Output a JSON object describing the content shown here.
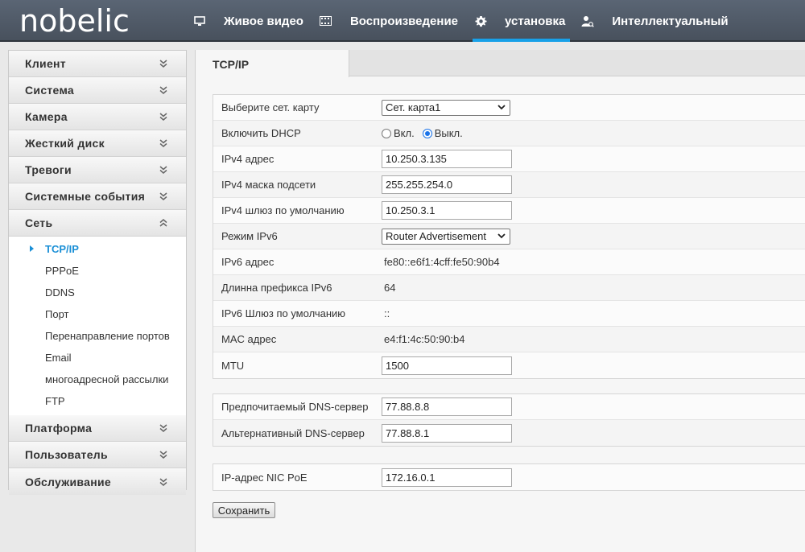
{
  "brand": {
    "logo": "nobelic"
  },
  "nav": [
    {
      "icon": "monitor-icon",
      "label": "Живое видео",
      "active": false
    },
    {
      "icon": "film-icon",
      "label": "Воспроизведение",
      "active": false
    },
    {
      "icon": "gear-icon",
      "label": "установка",
      "active": true
    },
    {
      "icon": "person-search-icon",
      "label": "Интеллектуальный",
      "active": false
    }
  ],
  "sidebar": {
    "groups_top": [
      "Клиент",
      "Система",
      "Камера",
      "Жесткий диск",
      "Тревоги",
      "Системные события"
    ],
    "open_group": "Сеть",
    "sub_items": [
      "TCP/IP",
      "PPPoE",
      "DDNS",
      "Порт",
      "Перенаправление портов",
      "Email",
      "многоадресной рассылки",
      "FTP"
    ],
    "active_sub": "TCP/IP",
    "groups_bottom": [
      "Платформа",
      "Пользователь",
      "Обслуживание"
    ]
  },
  "content": {
    "tab": "TCP/IP",
    "nic": {
      "label": "Выберите сет. карту",
      "value": "Сет. карта1"
    },
    "dhcp": {
      "label": "Включить DHCP",
      "on_label": "Вкл.",
      "off_label": "Выкл.",
      "selected": "off"
    },
    "ipv4_addr": {
      "label": "IPv4 адрес",
      "value": "10.250.3.135"
    },
    "ipv4_mask": {
      "label": "IPv4 маска подсети",
      "value": "255.255.254.0"
    },
    "ipv4_gw": {
      "label": "IPv4 шлюз по умолчанию",
      "value": "10.250.3.1"
    },
    "ipv6_mode": {
      "label": "Режим IPv6",
      "value": "Router Advertisement"
    },
    "ipv6_addr": {
      "label": "IPv6 адрес",
      "value": "fe80::e6f1:4cff:fe50:90b4"
    },
    "ipv6_prefix": {
      "label": "Длинна префикса IPv6",
      "value": "64"
    },
    "ipv6_gw": {
      "label": "IPv6 Шлюз по умолчанию",
      "value": "::"
    },
    "mac": {
      "label": "MAC адрес",
      "value": "e4:f1:4c:50:90:b4"
    },
    "mtu": {
      "label": "MTU",
      "value": "1500"
    },
    "dns_pref": {
      "label": "Предпочитаемый DNS-сервер",
      "value": "77.88.8.8"
    },
    "dns_alt": {
      "label": "Альтернативный DNS-сервер",
      "value": "77.88.8.1"
    },
    "poe_ip": {
      "label": "IP-адрес NIC PoE",
      "value": "172.16.0.1"
    },
    "save_label": "Сохранить"
  },
  "colors": {
    "accent": "#18a1e8",
    "link_active": "#1a8fd6",
    "topbar": "#4f5966"
  }
}
